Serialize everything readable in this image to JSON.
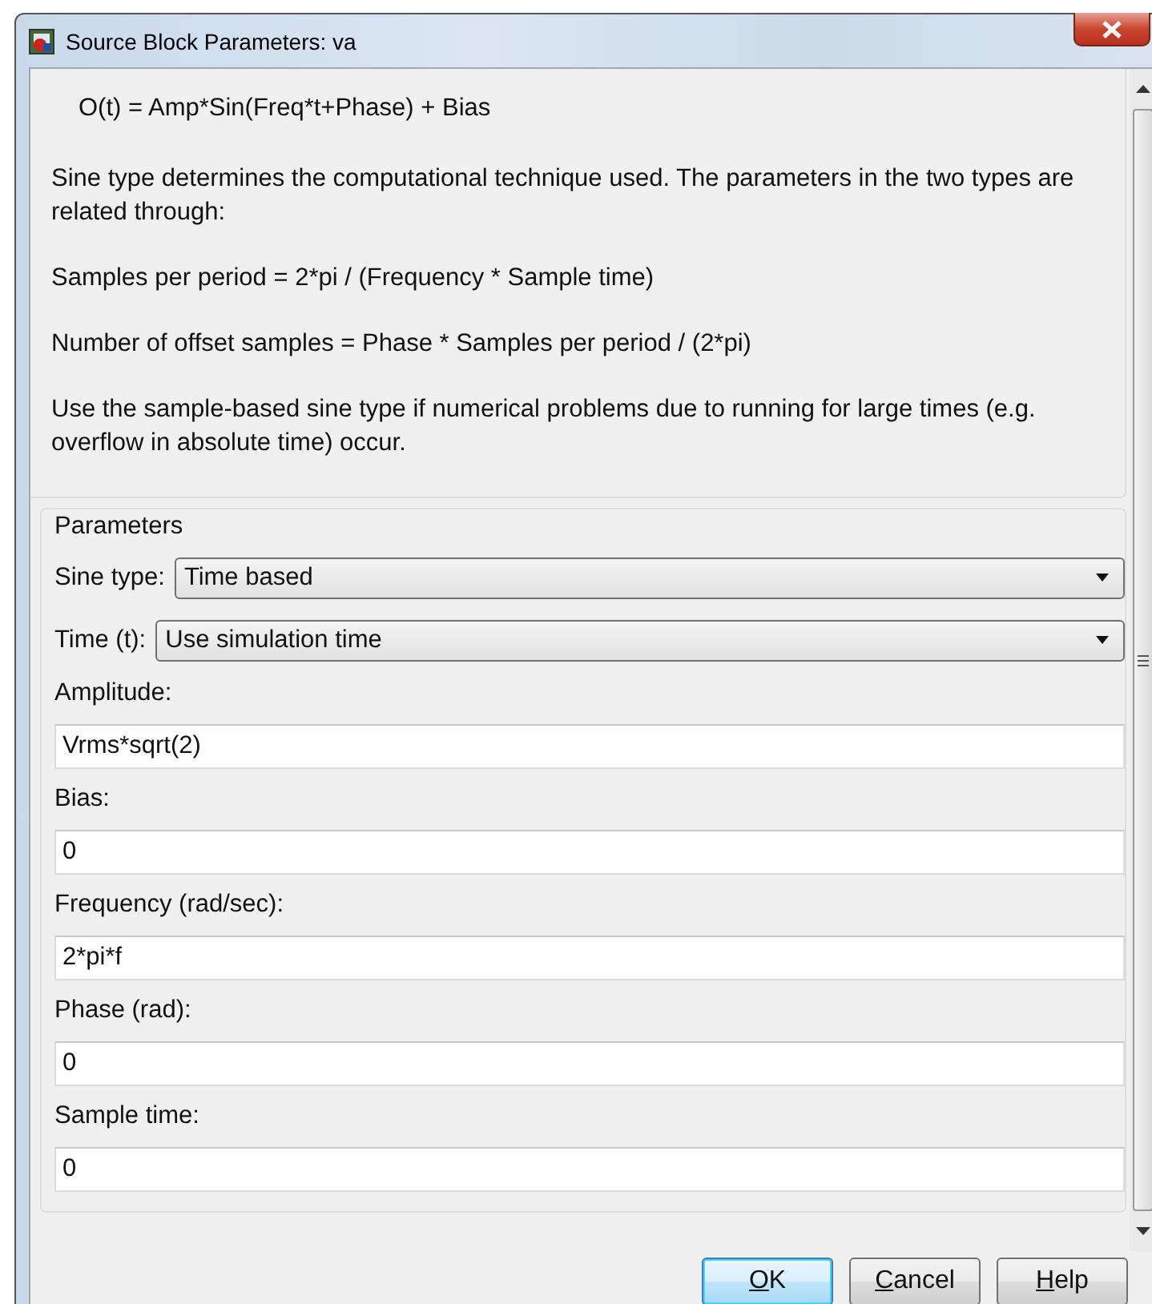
{
  "window": {
    "title": "Source Block Parameters: va"
  },
  "description": [
    {
      "kind": "formula",
      "text": "O(t) = Amp*Sin(Freq*t+Phase) + Bias"
    },
    {
      "kind": "text",
      "text": "Sine type determines the computational technique used. The parameters in the two types are related through:"
    },
    {
      "kind": "text",
      "text": "Samples per period = 2*pi / (Frequency * Sample time)"
    },
    {
      "kind": "text",
      "text": "Number of offset samples = Phase * Samples per period / (2*pi)"
    },
    {
      "kind": "text",
      "text": "Use the sample-based sine type if numerical problems due to running for large times (e.g. overflow in absolute time) occur."
    }
  ],
  "parameters": {
    "title": "Parameters",
    "controls": [
      {
        "kind": "combo",
        "label": "Sine type:",
        "value": "Time based"
      },
      {
        "kind": "combo",
        "label": "Time (t):",
        "value": "Use simulation time"
      },
      {
        "kind": "field",
        "label": "Amplitude:",
        "value": "Vrms*sqrt(2)"
      },
      {
        "kind": "field",
        "label": "Bias:",
        "value": "0"
      },
      {
        "kind": "field",
        "label": "Frequency (rad/sec):",
        "value": "2*pi*f"
      },
      {
        "kind": "field",
        "label": "Phase (rad):",
        "value": "0"
      },
      {
        "kind": "field",
        "label": "Sample time:",
        "value": "0"
      }
    ]
  },
  "buttons": [
    {
      "label": "OK",
      "default": true
    },
    {
      "label": "Cancel",
      "default": false
    },
    {
      "label": "Help",
      "default": false
    }
  ]
}
